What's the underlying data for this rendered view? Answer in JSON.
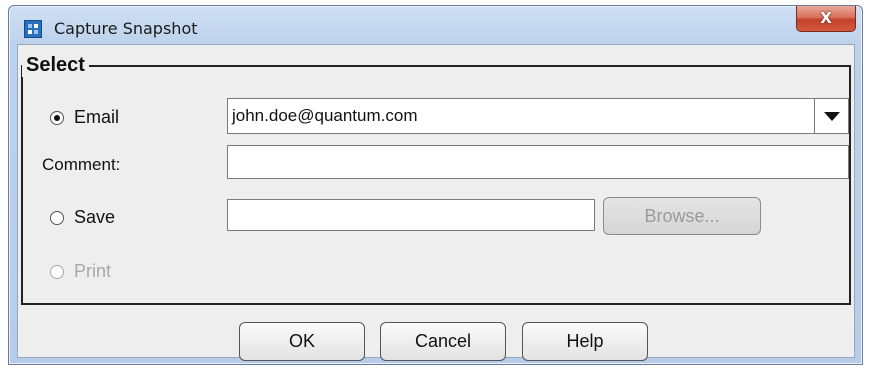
{
  "window": {
    "title": "Capture Snapshot",
    "close_label": "X"
  },
  "group": {
    "legend": "Select"
  },
  "options": {
    "email_label": "Email",
    "email_selected": true,
    "email_value": "john.doe@quantum.com",
    "comment_label": "Comment:",
    "comment_value": "",
    "save_label": "Save",
    "save_selected": false,
    "save_path_value": "",
    "browse_label": "Browse...",
    "print_label": "Print",
    "print_enabled": false
  },
  "buttons": {
    "ok_label": "OK",
    "cancel_label": "Cancel",
    "help_label": "Help"
  },
  "colors": {
    "titlebar": "#bcd1ec",
    "close_button": "#c2412a",
    "dialog_background": "#eeeeee"
  }
}
